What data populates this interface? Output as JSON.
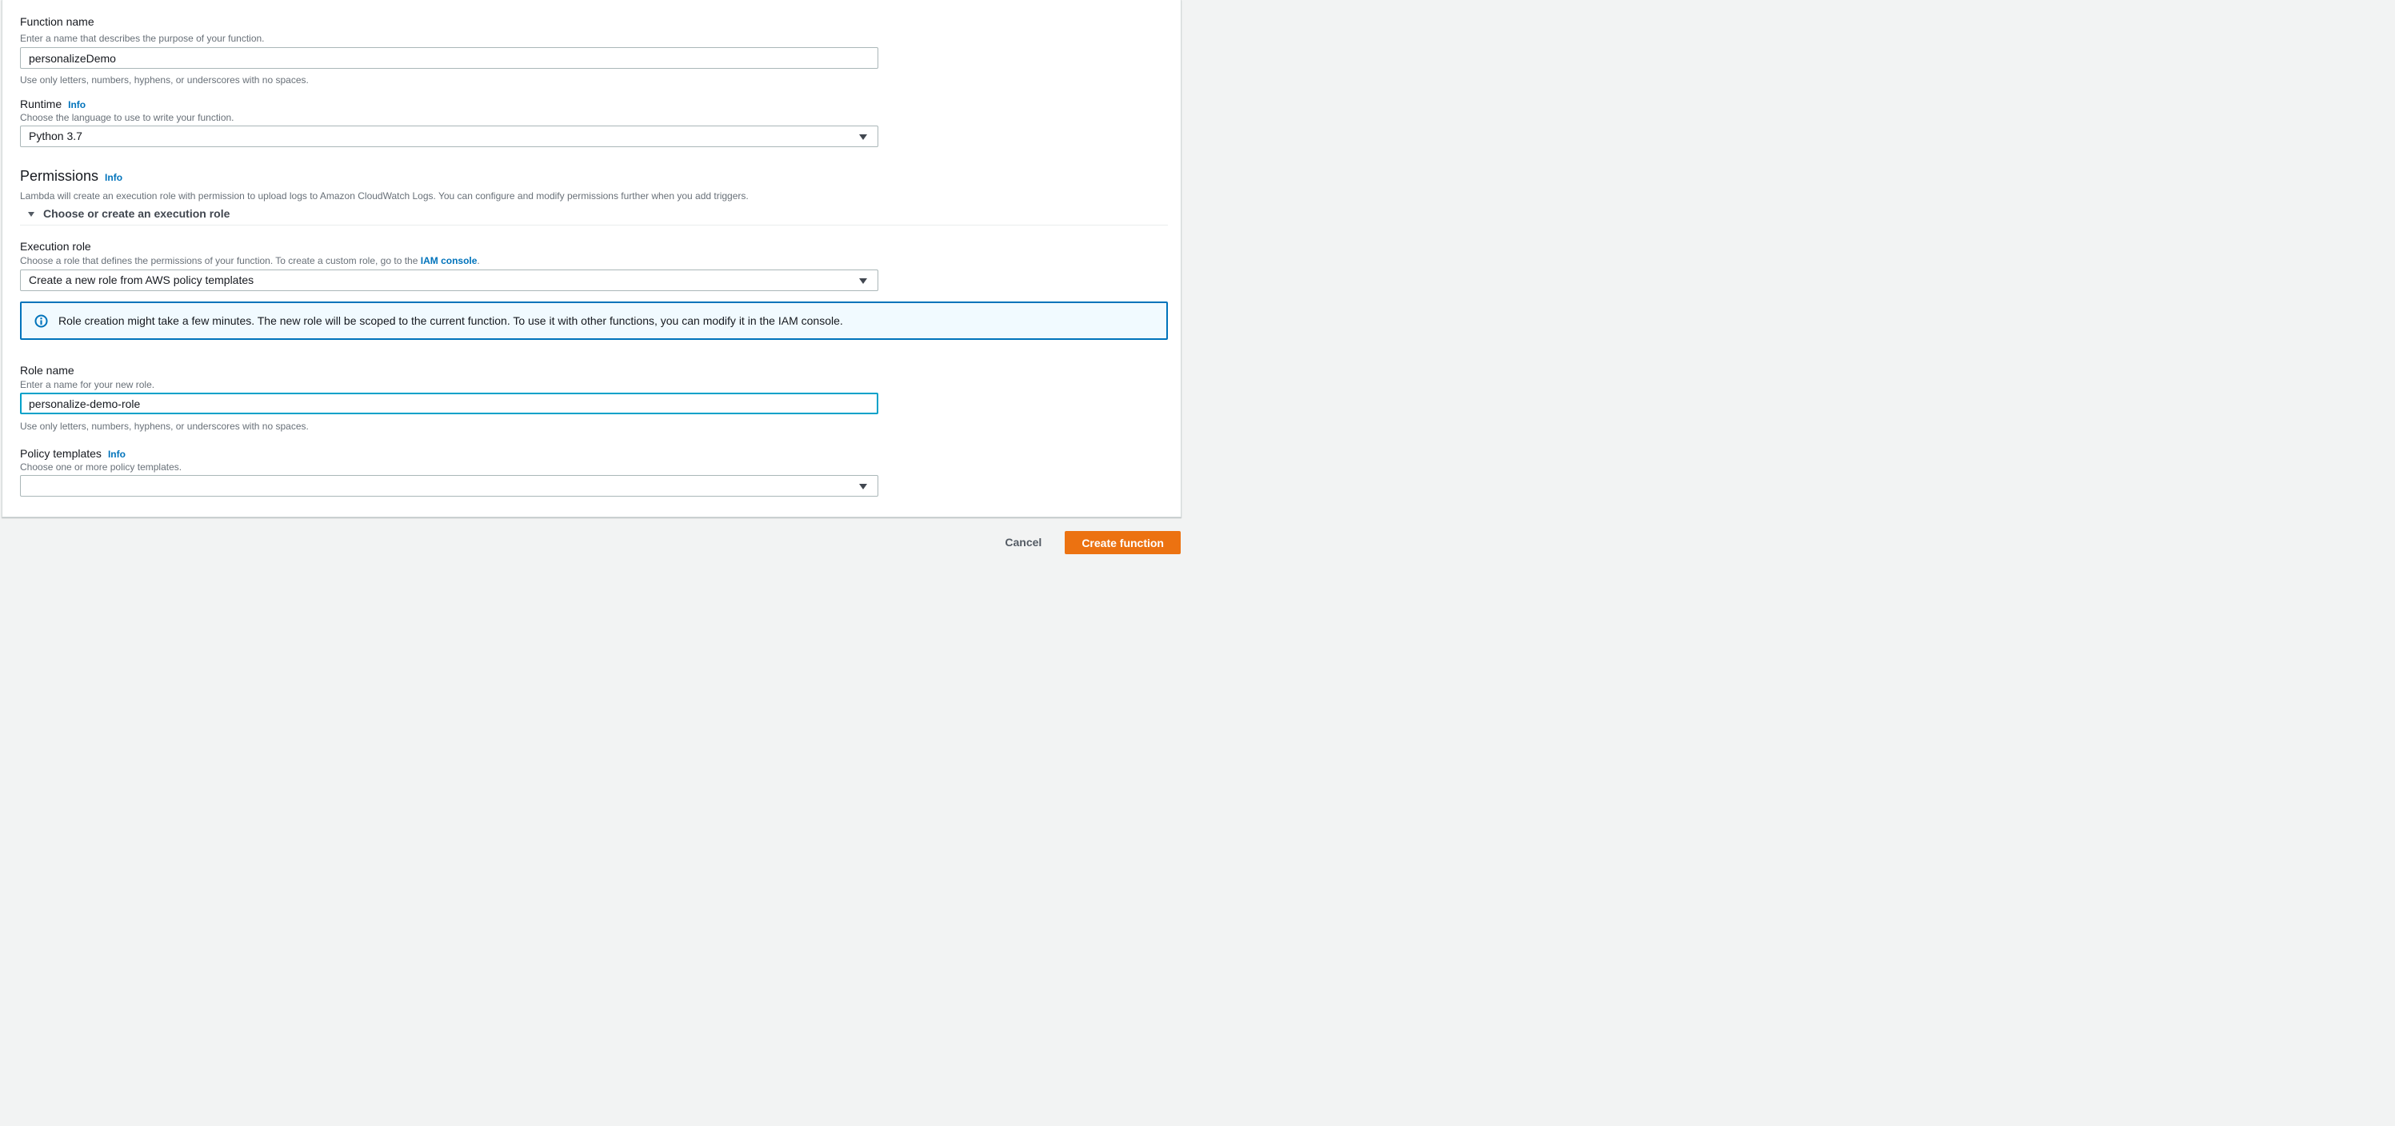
{
  "form": {
    "function_name": {
      "label": "Function name",
      "description": "Enter a name that describes the purpose of your function.",
      "value": "personalizeDemo",
      "constraint": "Use only letters, numbers, hyphens, or underscores with no spaces."
    },
    "runtime": {
      "label": "Runtime",
      "info_label": "Info",
      "description": "Choose the language to use to write your function.",
      "value": "Python 3.7"
    },
    "permissions": {
      "heading": "Permissions",
      "info_label": "Info",
      "description": "Lambda will create an execution role with permission to upload logs to Amazon CloudWatch Logs. You can configure and modify permissions further when you add triggers.",
      "expander_label": "Choose or create an execution role"
    },
    "execution_role": {
      "label": "Execution role",
      "description_before_link": "Choose a role that defines the permissions of your function. To create a custom role, go to the ",
      "link_text": "IAM console",
      "description_after_link": ".",
      "value": "Create a new role from AWS policy templates"
    },
    "role_alert": {
      "text": "Role creation might take a few minutes. The new role will be scoped to the current function. To use it with other functions, you can modify it in the IAM console."
    },
    "role_name": {
      "label": "Role name",
      "description": "Enter a name for your new role.",
      "value": "personalize-demo-role",
      "constraint": "Use only letters, numbers, hyphens, or underscores with no spaces."
    },
    "policy_templates": {
      "label": "Policy templates",
      "info_label": "Info",
      "description": "Choose one or more policy templates.",
      "value": ""
    }
  },
  "footer": {
    "cancel_label": "Cancel",
    "create_label": "Create function"
  },
  "icons": {
    "caret_down": "caret-down-icon",
    "info_circle": "info-circle-icon"
  },
  "colors": {
    "accent_orange": "#ec7211",
    "link_blue": "#0073bb",
    "focus_teal": "#00a1c9",
    "alert_background": "#f1faff",
    "alert_border": "#0073bb",
    "page_background": "#f2f3f3"
  }
}
